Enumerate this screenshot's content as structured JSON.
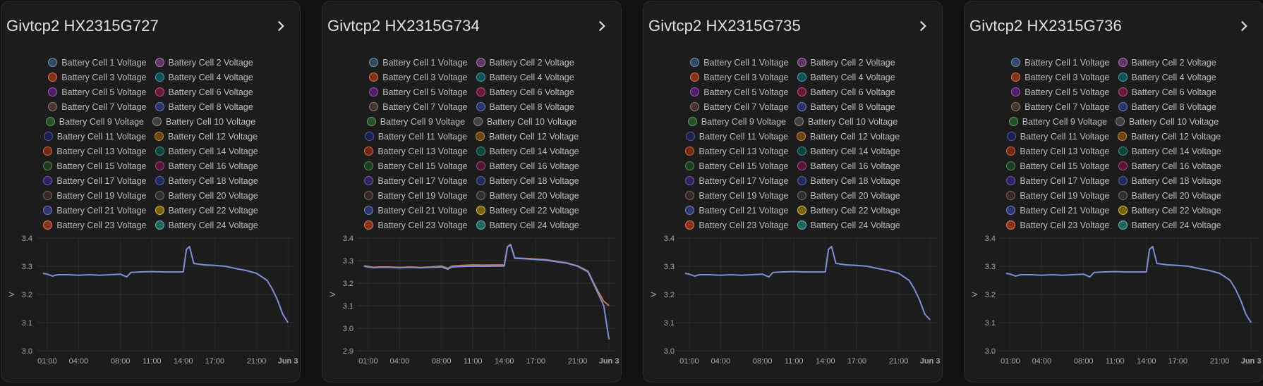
{
  "cards": [
    {
      "title": "Givtcp2 HX2315G727",
      "chart_data": {
        "type": "line",
        "ylabel": "V",
        "ylim": [
          3.0,
          3.4
        ],
        "yticks": [
          "3.4",
          "3.3",
          "3.2",
          "3.1",
          "3.0"
        ],
        "xticks": [
          "01:00",
          "04:00",
          "08:00",
          "11:00",
          "14:00",
          "17:00",
          "21:00",
          "Jun 3"
        ],
        "x_hours": [
          0.6,
          1,
          1.5,
          2,
          3,
          4,
          5,
          6,
          7,
          8,
          8.6,
          9,
          10,
          11,
          12,
          13,
          14,
          14.3,
          14.6,
          15,
          16,
          17,
          18,
          19,
          20,
          21,
          22,
          22.5,
          23,
          23.5,
          24
        ],
        "series": [
          {
            "values": [
              3.275,
              3.272,
              3.265,
              3.27,
              3.27,
              3.268,
              3.27,
              3.268,
              3.27,
              3.272,
              3.262,
              3.278,
              3.28,
              3.281,
              3.28,
              3.28,
              3.28,
              3.36,
              3.37,
              3.31,
              3.305,
              3.303,
              3.3,
              3.292,
              3.285,
              3.275,
              3.25,
              3.22,
              3.18,
              3.13,
              3.1
            ]
          }
        ]
      }
    },
    {
      "title": "Givtcp2 HX2315G734",
      "chart_data": {
        "type": "line",
        "ylabel": "V",
        "ylim": [
          2.9,
          3.4
        ],
        "yticks": [
          "3.4",
          "3.3",
          "3.2",
          "3.1",
          "3.0",
          "2.9"
        ],
        "xticks": [
          "01:00",
          "04:00",
          "08:00",
          "11:00",
          "14:00",
          "17:00",
          "21:00",
          "Jun 3"
        ],
        "x_hours": [
          0.6,
          1,
          1.5,
          2,
          3,
          4,
          5,
          6,
          7,
          8,
          8.6,
          9,
          10,
          11,
          12,
          13,
          14,
          14.3,
          14.6,
          15,
          16,
          17,
          18,
          19,
          20,
          21,
          22,
          22.5,
          23,
          23.5,
          24
        ],
        "series": [
          {
            "values": [
              3.275,
              3.272,
              3.268,
              3.27,
              3.27,
              3.268,
              3.27,
              3.268,
              3.27,
              3.272,
              3.262,
              3.272,
              3.274,
              3.276,
              3.275,
              3.276,
              3.276,
              3.36,
              3.37,
              3.31,
              3.308,
              3.305,
              3.302,
              3.295,
              3.288,
              3.275,
              3.25,
              3.2,
              3.15,
              3.1,
              2.95
            ]
          },
          {
            "values": [
              3.277,
              3.274,
              3.27,
              3.272,
              3.272,
              3.27,
              3.272,
              3.27,
              3.272,
              3.276,
              3.266,
              3.276,
              3.279,
              3.281,
              3.28,
              3.281,
              3.281,
              3.362,
              3.372,
              3.312,
              3.31,
              3.307,
              3.304,
              3.297,
              3.29,
              3.277,
              3.253,
              3.205,
              3.16,
              3.12,
              3.1
            ]
          }
        ]
      }
    },
    {
      "title": "Givtcp2 HX2315G735",
      "chart_data": {
        "type": "line",
        "ylabel": "V",
        "ylim": [
          3.0,
          3.4
        ],
        "yticks": [
          "3.4",
          "3.3",
          "3.2",
          "3.1",
          "3.0"
        ],
        "xticks": [
          "01:00",
          "04:00",
          "08:00",
          "11:00",
          "14:00",
          "17:00",
          "21:00",
          "Jun 3"
        ],
        "x_hours": [
          0.6,
          1,
          1.5,
          2,
          3,
          4,
          5,
          6,
          7,
          8,
          8.6,
          9,
          10,
          11,
          12,
          13,
          14,
          14.3,
          14.6,
          15,
          16,
          17,
          18,
          19,
          20,
          21,
          22,
          22.5,
          23,
          23.5,
          24
        ],
        "series": [
          {
            "values": [
              3.275,
              3.272,
              3.265,
              3.27,
              3.27,
              3.268,
              3.27,
              3.268,
              3.27,
              3.272,
              3.262,
              3.278,
              3.28,
              3.281,
              3.28,
              3.28,
              3.28,
              3.36,
              3.37,
              3.31,
              3.305,
              3.303,
              3.3,
              3.292,
              3.285,
              3.275,
              3.25,
              3.22,
              3.18,
              3.13,
              3.11
            ]
          }
        ]
      }
    },
    {
      "title": "Givtcp2 HX2315G736",
      "chart_data": {
        "type": "line",
        "ylabel": "V",
        "ylim": [
          3.0,
          3.4
        ],
        "yticks": [
          "3.4",
          "3.3",
          "3.2",
          "3.1",
          "3.0"
        ],
        "xticks": [
          "01:00",
          "04:00",
          "08:00",
          "11:00",
          "14:00",
          "17:00",
          "21:00",
          "Jun 3"
        ],
        "x_hours": [
          0.6,
          1,
          1.5,
          2,
          3,
          4,
          5,
          6,
          7,
          8,
          8.6,
          9,
          10,
          11,
          12,
          13,
          14,
          14.3,
          14.6,
          15,
          16,
          17,
          18,
          19,
          20,
          21,
          22,
          22.5,
          23,
          23.5,
          24
        ],
        "series": [
          {
            "values": [
              3.275,
              3.272,
              3.265,
              3.27,
              3.27,
              3.268,
              3.27,
              3.268,
              3.27,
              3.272,
              3.262,
              3.278,
              3.28,
              3.281,
              3.28,
              3.28,
              3.28,
              3.36,
              3.37,
              3.31,
              3.305,
              3.303,
              3.3,
              3.292,
              3.285,
              3.275,
              3.25,
              3.22,
              3.18,
              3.13,
              3.1
            ]
          }
        ]
      }
    }
  ],
  "legend": [
    [
      "Battery Cell 1 Voltage",
      "Battery Cell 2 Voltage"
    ],
    [
      "Battery Cell 3 Voltage",
      "Battery Cell 4 Voltage"
    ],
    [
      "Battery Cell 5 Voltage",
      "Battery Cell 6 Voltage"
    ],
    [
      "Battery Cell 7 Voltage",
      "Battery Cell 8 Voltage"
    ],
    [
      "Battery Cell 9 Voltage",
      "Battery Cell 10 Voltage"
    ],
    [
      "Battery Cell 11 Voltage",
      "Battery Cell 12 Voltage"
    ],
    [
      "Battery Cell 13 Voltage",
      "Battery Cell 14 Voltage"
    ],
    [
      "Battery Cell 15 Voltage",
      "Battery Cell 16 Voltage"
    ],
    [
      "Battery Cell 17 Voltage",
      "Battery Cell 18 Voltage"
    ],
    [
      "Battery Cell 19 Voltage",
      "Battery Cell 20 Voltage"
    ],
    [
      "Battery Cell 21 Voltage",
      "Battery Cell 22 Voltage"
    ],
    [
      "Battery Cell 23 Voltage",
      "Battery Cell 24 Voltage"
    ]
  ],
  "legend_colors": [
    [
      "#44739e",
      "#984ea3"
    ],
    [
      "#d84315",
      "#00838f"
    ],
    [
      "#7b1fa2",
      "#ad1457"
    ],
    [
      "#6d4c41",
      "#3949ab"
    ],
    [
      "#2e7d32",
      "#616161"
    ],
    [
      "#1a237e",
      "#b26a00"
    ],
    [
      "#bf360c",
      "#00695c"
    ],
    [
      "#1b5e20",
      "#880e4f"
    ],
    [
      "#4527a0",
      "#283593"
    ],
    [
      "#4e342e",
      "#424242"
    ],
    [
      "#3f51b5",
      "#c8a200"
    ],
    [
      "#e64a19",
      "#26a69a"
    ]
  ],
  "line_colors": [
    "#7e8fd9",
    "#c47a52"
  ],
  "icons": {
    "chevron": "chevron-right-icon"
  }
}
